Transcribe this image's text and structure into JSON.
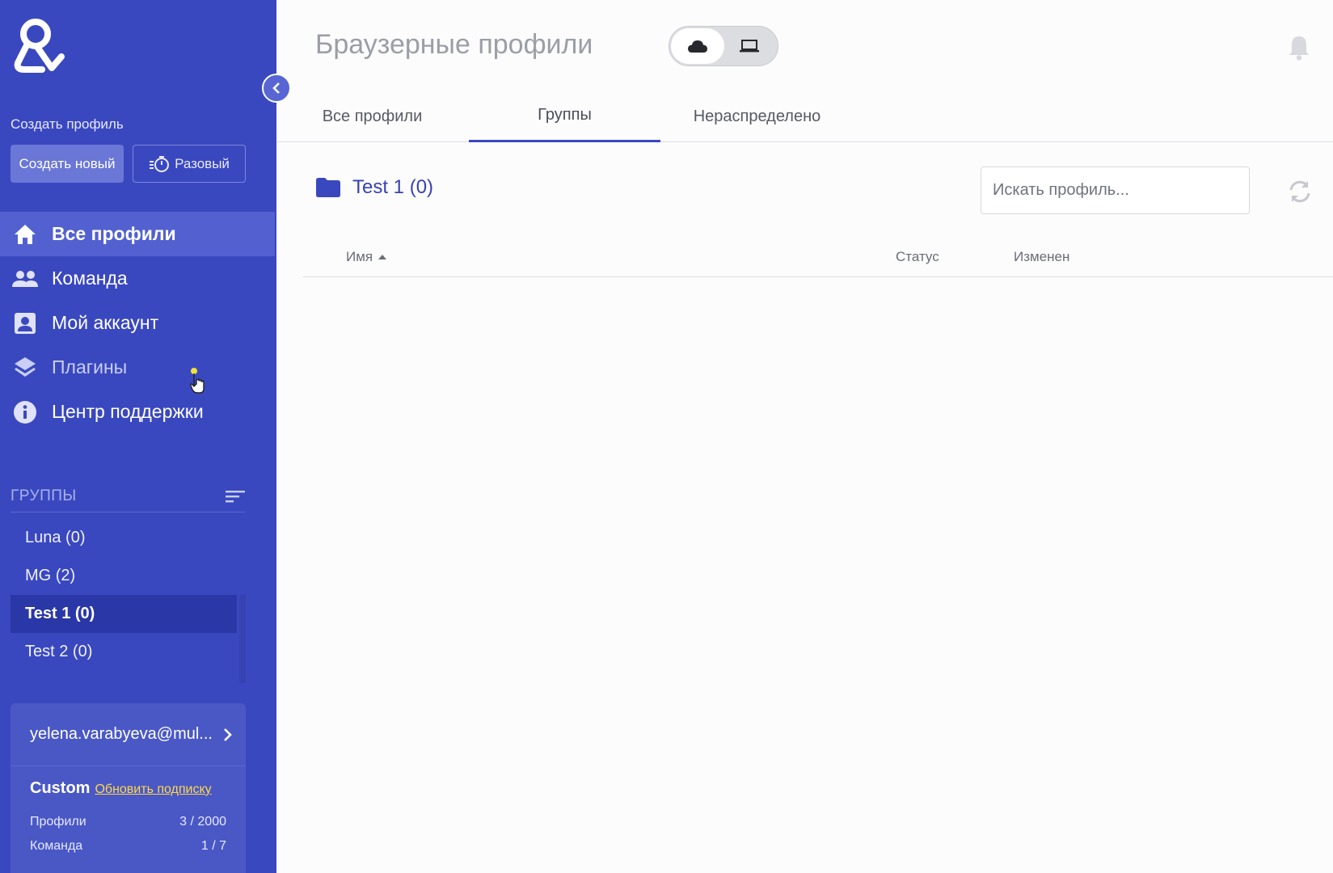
{
  "sidebar": {
    "create_label": "Создать профиль",
    "create_new": "Создать новый",
    "one_time": "Разовый",
    "nav": [
      {
        "label": "Все профили",
        "icon": "home-icon",
        "active": true
      },
      {
        "label": "Команда",
        "icon": "team-icon",
        "active": false
      },
      {
        "label": "Мой аккаунт",
        "icon": "account-icon",
        "active": false
      },
      {
        "label": "Плагины",
        "icon": "layers-icon",
        "active": false
      },
      {
        "label": "Центр поддержки",
        "icon": "info-icon",
        "active": false
      }
    ],
    "groups_title": "ГРУППЫ",
    "groups": [
      {
        "label": "Luna  (0)",
        "active": false
      },
      {
        "label": "MG  (2)",
        "active": false
      },
      {
        "label": "Test 1  (0)",
        "active": true
      },
      {
        "label": "Test 2  (0)",
        "active": false
      }
    ],
    "account": {
      "email": "yelena.varabyeva@mul...",
      "plan": "Custom",
      "upgrade_link": "Обновить подписку",
      "stats": [
        {
          "label": "Профили",
          "value": "3 / 2000"
        },
        {
          "label": "Команда",
          "value": "1 / 7"
        }
      ]
    }
  },
  "header": {
    "title": "Браузерные профили",
    "toggle": {
      "cloud_icon": "cloud-icon",
      "local_icon": "laptop-icon"
    }
  },
  "tabs": [
    {
      "label": "Все профили",
      "active": false
    },
    {
      "label": "Группы",
      "active": true
    },
    {
      "label": "Нераспределено",
      "active": false
    }
  ],
  "content": {
    "folder_title": "Test 1 (0)",
    "search_placeholder": "Искать профиль...",
    "columns": {
      "name": "Имя",
      "status": "Статус",
      "modified": "Изменен"
    }
  },
  "colors": {
    "sidebar_bg": "#3a48bf",
    "accent": "#3a48bf",
    "upgrade_link": "#ffd84a"
  }
}
